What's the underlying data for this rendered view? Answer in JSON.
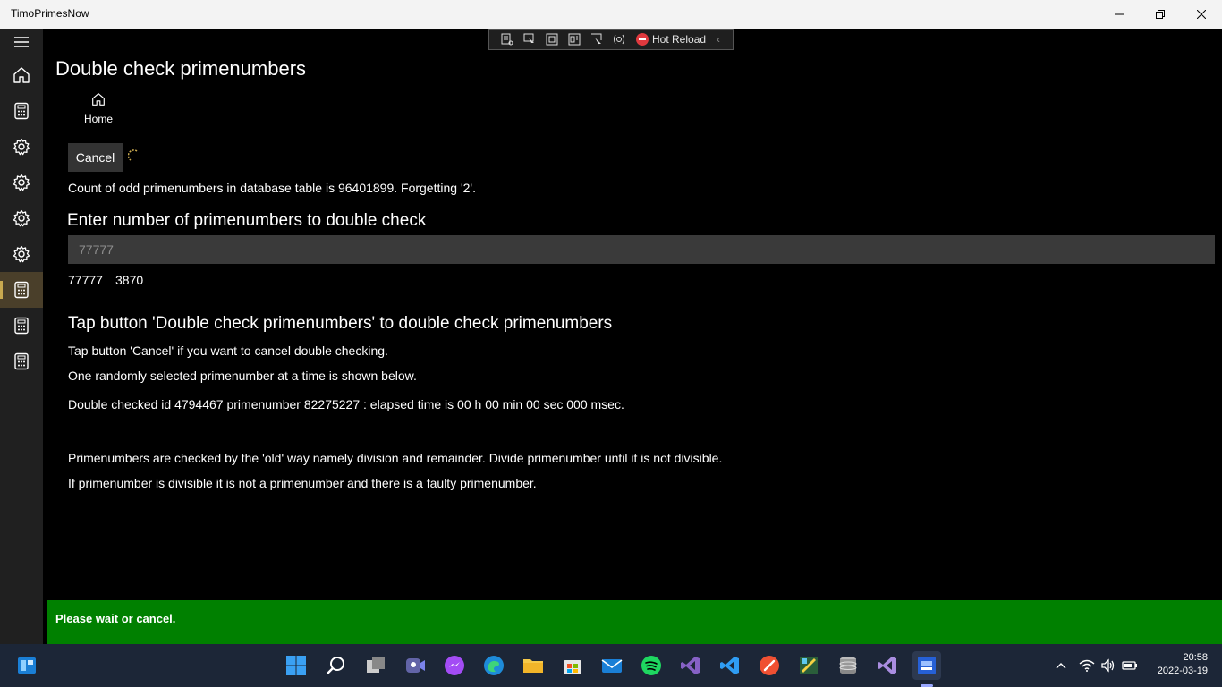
{
  "window": {
    "title": "TimoPrimesNow",
    "controls": [
      "minimize-icon",
      "maximize-icon",
      "close-icon"
    ]
  },
  "nav": {
    "items": [
      {
        "name": "hamburger-menu",
        "icon": "menu-icon"
      },
      {
        "name": "home",
        "icon": "home-icon"
      },
      {
        "name": "calculator-1",
        "icon": "calculator-icon"
      },
      {
        "name": "settings-1",
        "icon": "gear-icon"
      },
      {
        "name": "settings-2",
        "icon": "gear-icon"
      },
      {
        "name": "settings-3",
        "icon": "gear-icon"
      },
      {
        "name": "settings-4",
        "icon": "gear-icon"
      },
      {
        "name": "calculator-2",
        "icon": "calculator-icon",
        "selected": true
      },
      {
        "name": "calculator-3",
        "icon": "calculator-icon"
      },
      {
        "name": "calculator-4",
        "icon": "calculator-icon"
      }
    ],
    "selected_color": "#4a3f2a"
  },
  "hot_reload": {
    "label": "Hot Reload",
    "icons": [
      "live-tree-icon",
      "select-element-icon",
      "display-layout-icon",
      "track-focus-icon",
      "cursor-select-icon",
      "binding-icon"
    ]
  },
  "page": {
    "title": "Double check primenumbers",
    "home_label": "Home",
    "cancel_label": "Cancel",
    "count_text": "Count of odd primenumbers in database table is 96401899. Forgetting '2'.",
    "enter_heading": "Enter number of primenumbers to double check",
    "input_placeholder": "77777",
    "input_value": "",
    "input_echo": "77777",
    "progress_count": "3870",
    "tap_heading": "Tap button 'Double check primenumbers' to double check primenumbers",
    "tap_cancel_text": "Tap button 'Cancel' if you want to cancel double checking.",
    "random_text": "One randomly selected primenumber at a time is shown below.",
    "checked_text": "Double checked id 4794467 primenumber 82275227 : elapsed time is 00 h 00 min 00 sec 000 msec.",
    "explain_1": "Primenumbers are checked by the 'old' way namely division and remainder. Divide primenumber until it is not divisible.",
    "explain_2": "If primenumber is divisible it is not a primenumber and there is a faulty primenumber."
  },
  "status": {
    "message": "Please wait or cancel.",
    "color": "#008000"
  },
  "taskbar": {
    "apps": [
      "start-icon",
      "search-icon",
      "task-view-icon",
      "teams-icon",
      "messenger-icon",
      "edge-icon",
      "file-explorer-icon",
      "store-icon",
      "mail-icon",
      "spotify-icon",
      "visual-studio-icon",
      "vscode-icon",
      "git-icon",
      "sketch-icon",
      "database-icon",
      "visual-studio-preview-icon",
      "timoprimesnow-icon"
    ],
    "time": "20:58",
    "date": "2022-03-19"
  }
}
